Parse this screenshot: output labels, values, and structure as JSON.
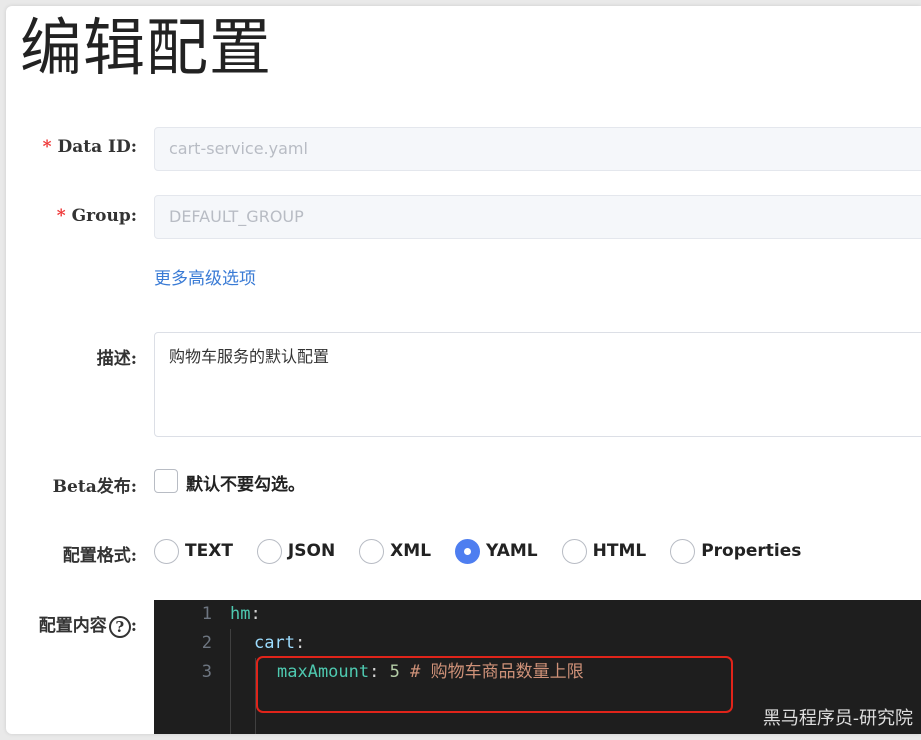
{
  "page_title": "编辑配置",
  "form": {
    "data_id": {
      "label": "Data ID:",
      "value": "cart-service.yaml"
    },
    "group": {
      "label": "Group:",
      "value": "DEFAULT_GROUP"
    },
    "required_mark": "*",
    "more_options_link": "更多高级选项",
    "description": {
      "label": "描述:",
      "value": "购物车服务的默认配置"
    },
    "beta": {
      "label": "Beta发布:",
      "checkbox_text": "默认不要勾选。",
      "checked": false
    },
    "format": {
      "label": "配置格式:",
      "options": [
        "TEXT",
        "JSON",
        "XML",
        "YAML",
        "HTML",
        "Properties"
      ],
      "selected": "YAML"
    },
    "content": {
      "label": "配置内容",
      "help_icon": "?",
      "lines": [
        {
          "num": "1",
          "key": "hm",
          "punct": ":"
        },
        {
          "num": "2",
          "key": "cart",
          "punct": ":"
        },
        {
          "num": "3",
          "key": "maxAmount",
          "punct": ":",
          "value": "5",
          "comment": "# 购物车商品数量上限"
        }
      ]
    }
  },
  "watermark": "黑马程序员-研究院",
  "colors": {
    "accent": "#4e7ef0",
    "link": "#3a7bd5",
    "highlight_border": "#e0241a",
    "editor_bg": "#1e1e1e"
  }
}
